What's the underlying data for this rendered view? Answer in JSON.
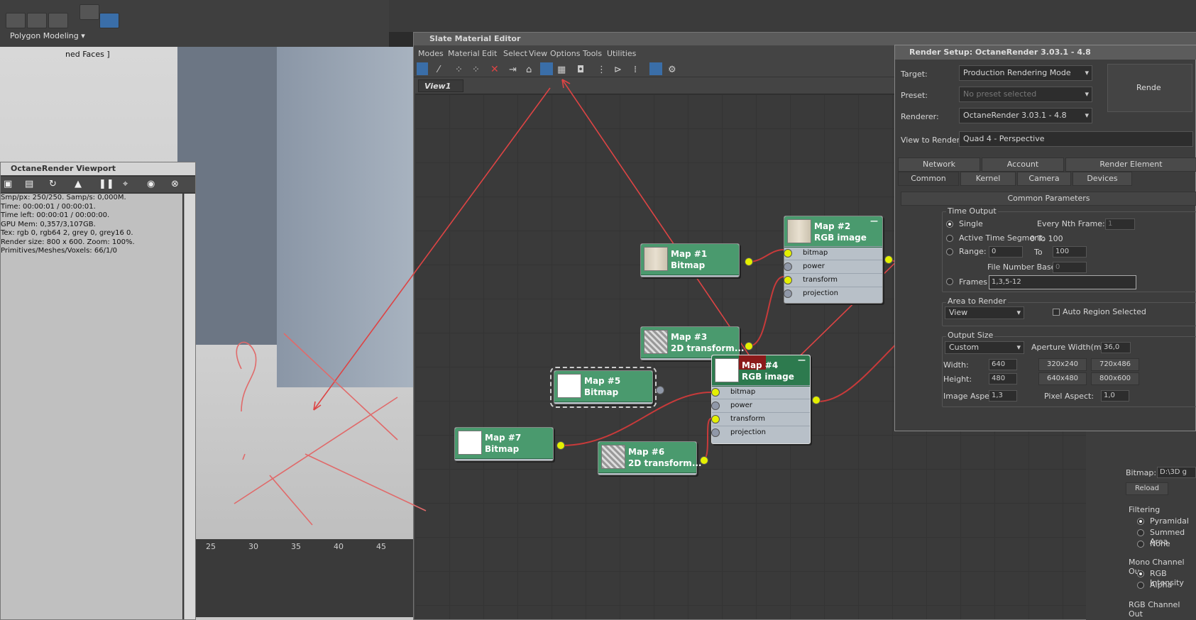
{
  "topbar": {
    "mode_label": "Polygon Modeling ▾"
  },
  "viewport": {
    "label": "ned Faces ]",
    "timeline": [
      "25",
      "30",
      "35",
      "40",
      "45"
    ]
  },
  "octane": {
    "title": "OctaneRender Viewport",
    "info": [
      "Smp/px: 250/250.   Samp/s: 0,000M.",
      "Time: 00:00:01 / 00:00:01.",
      "Time left: 00:00:01 / 00:00:00.",
      "GPU Mem: 0,357/3,107GB.",
      "Tex: rgb 0, rgb64 2, grey 0, grey16 0.",
      "Render size: 800 x 600.   Zoom: 100%.",
      "Primitives/Meshes/Voxels: 66/1/0"
    ]
  },
  "slate": {
    "title": "Slate Material Editor",
    "menu": [
      "Modes",
      "Material",
      "Edit",
      "Select",
      "View",
      "Options",
      "Tools",
      "Utilities"
    ],
    "view_tab": "View1",
    "nodes": {
      "map1": {
        "name": "Map #1",
        "type": "Bitmap"
      },
      "map2": {
        "name": "Map #2",
        "type": "RGB image",
        "slots": [
          "bitmap",
          "power",
          "transform",
          "projection"
        ]
      },
      "map3": {
        "name": "Map #3",
        "type": "2D transform..."
      },
      "map4": {
        "name": "Map #4",
        "type": "RGB image",
        "slots": [
          "bitmap",
          "power",
          "transform",
          "projection"
        ]
      },
      "map5": {
        "name": "Map #5",
        "type": "Bitmap"
      },
      "map6": {
        "name": "Map #6",
        "type": "2D transform..."
      },
      "map7": {
        "name": "Map #7",
        "type": "Bitmap"
      }
    }
  },
  "render_setup": {
    "title": "Render Setup: OctaneRender 3.03.1 - 4.8",
    "target_label": "Target:",
    "target_value": "Production Rendering Mode",
    "preset_label": "Preset:",
    "preset_value": "No preset selected",
    "renderer_label": "Renderer:",
    "renderer_value": "OctaneRender 3.03.1 - 4.8",
    "view_label": "View to Render:",
    "view_value": "Quad 4 - Perspective",
    "render_button": "Rende",
    "tabs_row1": [
      "Network",
      "Account",
      "Render Element"
    ],
    "tabs_row2": [
      "Common",
      "Kernel",
      "Camera",
      "Devices"
    ],
    "rollout": "Common Parameters",
    "time_output": {
      "label": "Time Output",
      "single": "Single",
      "every_nth": "Every Nth Frame:",
      "every_nth_value": "1",
      "active": "Active Time Segment:",
      "active_value": "0 To 100",
      "range": "Range:",
      "range_from": "0",
      "range_to_label": "To",
      "range_to": "100",
      "file_base": "File Number Base:",
      "file_base_value": "0",
      "frames": "Frames",
      "frames_value": "1,3,5-12"
    },
    "area": {
      "label": "Area to Render",
      "value": "View",
      "auto_region": "Auto Region Selected"
    },
    "output_size": {
      "label": "Output Size",
      "preset": "Custom",
      "aperture_label": "Aperture Width(mm):",
      "aperture_value": "36,0",
      "width_label": "Width:",
      "width_value": "640",
      "height_label": "Height:",
      "height_value": "480",
      "sizes": [
        "320x240",
        "720x486",
        "640x480",
        "800x600"
      ],
      "image_aspect_label": "Image Aspect:",
      "image_aspect_value": "1,3",
      "pixel_aspect_label": "Pixel Aspect:",
      "pixel_aspect_value": "1,0"
    }
  },
  "bitmap_panel": {
    "bitmap_label": "Bitmap:",
    "bitmap_value": "D:\\3D g",
    "reload": "Reload",
    "filtering_label": "Filtering",
    "filtering": [
      "Pyramidal",
      "Summed Area",
      "None"
    ],
    "mono_label": "Mono Channel Ou",
    "mono": [
      "RGB Intensity",
      "Alpha"
    ],
    "rgb_label": "RGB Channel Out"
  },
  "colors": {
    "wire": "#c83a3a",
    "node_green": "#4a9a6e",
    "socket_yellow": "#e4f000",
    "selected_node": "#8b1a1a"
  }
}
